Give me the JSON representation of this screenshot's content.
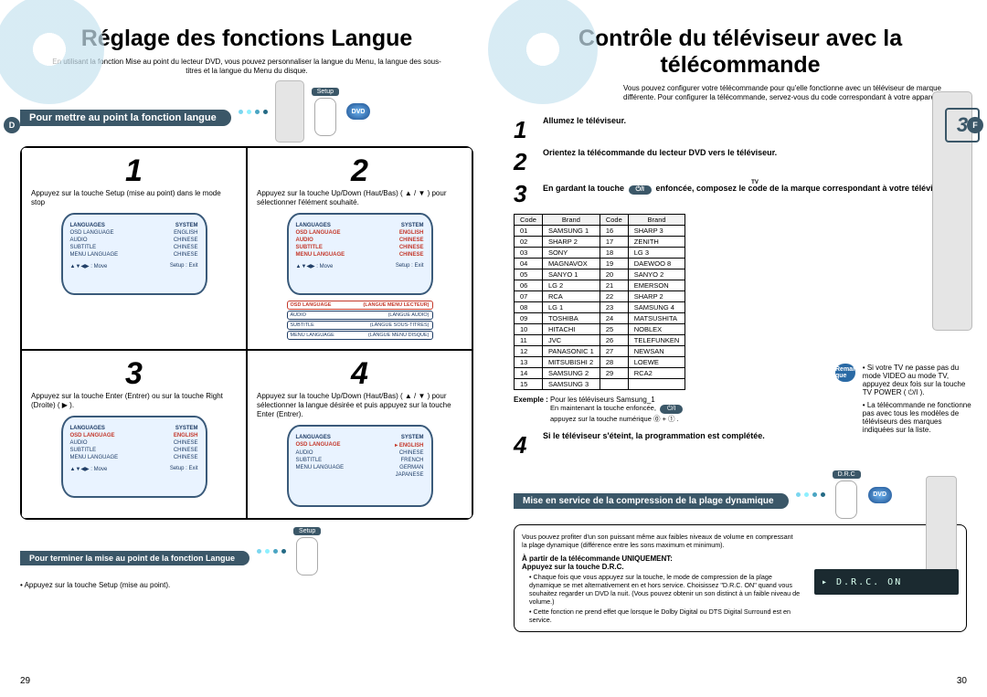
{
  "left": {
    "title": "Réglage des fonctions Langue",
    "intro": "En utilisant la fonction Mise au point du lecteur DVD, vous pouvez personnaliser la langue du Menu, la langue des sous-titres et la langue du Menu du disque.",
    "tab": "Pour mettre au point la fonction langue",
    "setup_label": "Setup",
    "dvd_badge": "DVD",
    "steps": {
      "1": {
        "num": "1",
        "text": "Appuyez sur la touche Setup (mise au point) dans le mode stop"
      },
      "2": {
        "num": "2",
        "text": "Appuyez sur la touche Up/Down (Haut/Bas) ( ▲ / ▼ ) pour sélectionner l'élément souhaité."
      },
      "3": {
        "num": "3",
        "text": "Appuyez sur la touche Enter (Entrer) ou sur la touche Right (Droite) (  ▶  )."
      },
      "4": {
        "num": "4",
        "text": "Appuyez sur la touche Up/Down (Haut/Bas) ( ▲ / ▼ ) pour sélectionner la langue désirée et puis appuyez sur la touche Enter (Entrer)."
      }
    },
    "tv_menu": {
      "head_l": "LANGUAGES",
      "head_r": "SYSTEM",
      "rows": [
        {
          "label": "OSD LANGUAGE",
          "value": "ENGLISH"
        },
        {
          "label": "AUDIO",
          "value": "CHINESE"
        },
        {
          "label": "SUBTITLE",
          "value": "CHINESE"
        },
        {
          "label": "MENU LANGUAGE",
          "value": "CHINESE"
        }
      ],
      "foot_l": "▲▼◀▶ : Move",
      "foot_r": "Setup : Exit"
    },
    "pill_menu": {
      "items": [
        {
          "label": "OSD LANGUAGE",
          "value": "(LANGUE MENU LECTEUR)",
          "sel": true
        },
        {
          "label": "AUDIO",
          "value": "(LANGUE AUDIO)"
        },
        {
          "label": "SUBTITLE",
          "value": "(LANGUE SOUS-TITRES)"
        },
        {
          "label": "MENU LANGUAGE",
          "value": "(LANGUE MENU DISQUE)"
        }
      ]
    },
    "tv4": {
      "rows": [
        {
          "label": "OSD LANGUAGE",
          "value": "▸ ENGLISH",
          "sel": true
        },
        {
          "label": "AUDIO",
          "value": "CHINESE"
        },
        {
          "label": "SUBTITLE",
          "value": "FRENCH"
        },
        {
          "label": "MENU LANGUAGE",
          "value": "GERMAN"
        }
      ],
      "extra": "JAPANESE"
    },
    "footer_label": "Pour terminer la mise au point de la fonction Langue",
    "footer_btn": "Setup",
    "footer_note": "• Appuyez sur la touche Setup (mise au point).",
    "pageno": "29"
  },
  "right": {
    "title": "Contrôle du téléviseur avec la télécommande",
    "intro": "Vous pouvez configurer votre télécommande pour qu'elle fonctionne avec un téléviseur de marque différente. Pour configurer la télécommande, servez-vous du code correspondant à votre appareil.",
    "steps": {
      "1": {
        "num": "1",
        "text": "Allumez le téléviseur."
      },
      "2": {
        "num": "2",
        "text": "Orientez la télécommande du lecteur DVD vers le téléviseur."
      },
      "3": {
        "num": "3",
        "text_a": "En gardant la touche",
        "text_b": "enfoncée, composez le code de la marque correspondant à votre téléviseur."
      },
      "4": {
        "num": "4",
        "text": "Si le téléviseur s'éteint, la programmation est complétée."
      }
    },
    "tv_chip_top": "TV",
    "tv_chip": "⏻/I",
    "table_headers": [
      "Code",
      "Brand",
      "Code",
      "Brand"
    ],
    "codes": [
      [
        "01",
        "SAMSUNG 1",
        "16",
        "SHARP 3"
      ],
      [
        "02",
        "SHARP 2",
        "17",
        "ZENITH"
      ],
      [
        "03",
        "SONY",
        "18",
        "LG 3"
      ],
      [
        "04",
        "MAGNAVOX",
        "19",
        "DAEWOO 8"
      ],
      [
        "05",
        "SANYO 1",
        "20",
        "SANYO 2"
      ],
      [
        "06",
        "LG 2",
        "21",
        "EMERSON"
      ],
      [
        "07",
        "RCA",
        "22",
        "SHARP 2"
      ],
      [
        "08",
        "LG 1",
        "23",
        "SAMSUNG 4"
      ],
      [
        "09",
        "TOSHIBA",
        "24",
        "MATSUSHITA"
      ],
      [
        "10",
        "HITACHI",
        "25",
        "NOBLEX"
      ],
      [
        "11",
        "JVC",
        "26",
        "TELEFUNKEN"
      ],
      [
        "12",
        "PANASONIC 1",
        "27",
        "NEWSAN"
      ],
      [
        "13",
        "MITSUBISHI 2",
        "28",
        "LOEWE"
      ],
      [
        "14",
        "SAMSUNG 2",
        "29",
        "RCA2"
      ],
      [
        "15",
        "SAMSUNG 3",
        "",
        ""
      ]
    ],
    "example_label": "Exemple :",
    "example_text": "Pour les téléviseurs Samsung_1",
    "example_sub1": "En maintenant la touche        enfoncée,",
    "example_sub2": "appuyez sur la touche numérique  ⓪ + ① .",
    "remark_label": "Remar que",
    "remark_items": [
      "Si votre TV ne passe pas du mode VIDEO au mode TV, appuyez deux fois sur la touche TV POWER ( ⏻/I ).",
      "La télécommande ne fonctionne pas avec tous les modèles de téléviseurs des marques indiquées sur la liste."
    ],
    "drc": {
      "tab": "Mise en service de la compression de la plage dynamique",
      "label": "D.R.C",
      "dvd": "DVD",
      "intro": "Vous pouvez profiter d'un son puissant même aux faibles niveaux de volume en compressant la plage dynamique (différence entre les sons maximum et minimum).",
      "head": "À partir de la télécommande UNIQUEMENT:",
      "sub": "Appuyez sur la touche D.R.C.",
      "bullets": [
        "Chaque fois que vous appuyez sur la touche, le mode de compression de la plage dynamique se met alternativement en et hors service. Choisissez \"D.R.C. ON\" quand vous souhaitez regarder un DVD la nuit. (Vous pouvez obtenir un son distinct à un faible niveau de volume.)",
        "Cette fonction ne prend effet que lorsque le Dolby Digital ou DTS Digital Surround est en service."
      ],
      "display": "▸ D.R.C.  ON"
    },
    "sideBadgeF": "F",
    "sideBadge3": "3",
    "pageno": "30"
  }
}
